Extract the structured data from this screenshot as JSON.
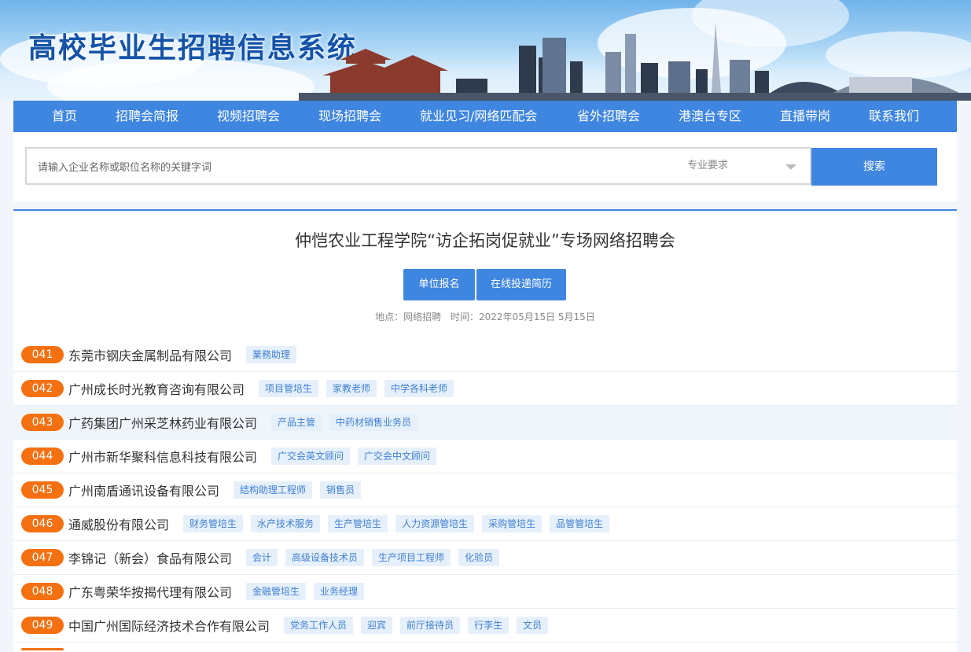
{
  "site": {
    "title": "高校毕业生招聘信息系统"
  },
  "nav": {
    "items": [
      {
        "label": "首页"
      },
      {
        "label": "招聘会简报"
      },
      {
        "label": "视频招聘会"
      },
      {
        "label": "现场招聘会"
      },
      {
        "label": "就业见习/网络匹配会"
      },
      {
        "label": "省外招聘会"
      },
      {
        "label": "港澳台专区"
      },
      {
        "label": "直播带岗"
      },
      {
        "label": "联系我们"
      }
    ]
  },
  "search": {
    "placeholder": "请输入企业名称或职位名称的关键字词",
    "major_select": "专业要求",
    "button": "搜索"
  },
  "fair": {
    "title": "仲恺农业工程学院“访企拓岗促就业”专场网络招聘会",
    "register_button": "单位报名",
    "resume_button": "在线投递简历",
    "location_label": "地点：网络招聘",
    "time_label": "时间：2022年05月15日 5月15日"
  },
  "companies": [
    {
      "num": "041",
      "name": "东莞市钢庆金属制品有限公司",
      "jobs": [
        "業務助理"
      ]
    },
    {
      "num": "042",
      "name": "广州成长时光教育咨询有限公司",
      "jobs": [
        "项目管培生",
        "家教老师",
        "中学各科老师"
      ]
    },
    {
      "num": "043",
      "name": "广药集团广州采芝林药业有限公司",
      "jobs": [
        "产品主管",
        "中药材销售业务员"
      ]
    },
    {
      "num": "044",
      "name": "广州市新华聚科信息科技有限公司",
      "jobs": [
        "广交会英文顾问",
        "广交会中文顾问"
      ]
    },
    {
      "num": "045",
      "name": "广州南盾通讯设备有限公司",
      "jobs": [
        "结构助理工程师",
        "销售员"
      ]
    },
    {
      "num": "046",
      "name": "通威股份有限公司",
      "jobs": [
        "财务管培生",
        "水产技术服务",
        "生产管培生",
        "人力资源管培生",
        "采购管培生",
        "品管管培生"
      ]
    },
    {
      "num": "047",
      "name": "李锦记（新会）食品有限公司",
      "jobs": [
        "会计",
        "高级设备技术员",
        "生产项目工程师",
        "化验员"
      ]
    },
    {
      "num": "048",
      "name": "广东粤荣华按揭代理有限公司",
      "jobs": [
        "金融管培生",
        "业务经理"
      ]
    },
    {
      "num": "049",
      "name": "中国广州国际经济技术合作有限公司",
      "jobs": [
        "党务工作人员",
        "迎宾",
        "前厅接待员",
        "行李生",
        "文员"
      ]
    }
  ],
  "colors": {
    "primary": "#3f86e0",
    "badge": "#f57010",
    "tag_bg": "#e6f0fb",
    "title": "#1553a8"
  }
}
